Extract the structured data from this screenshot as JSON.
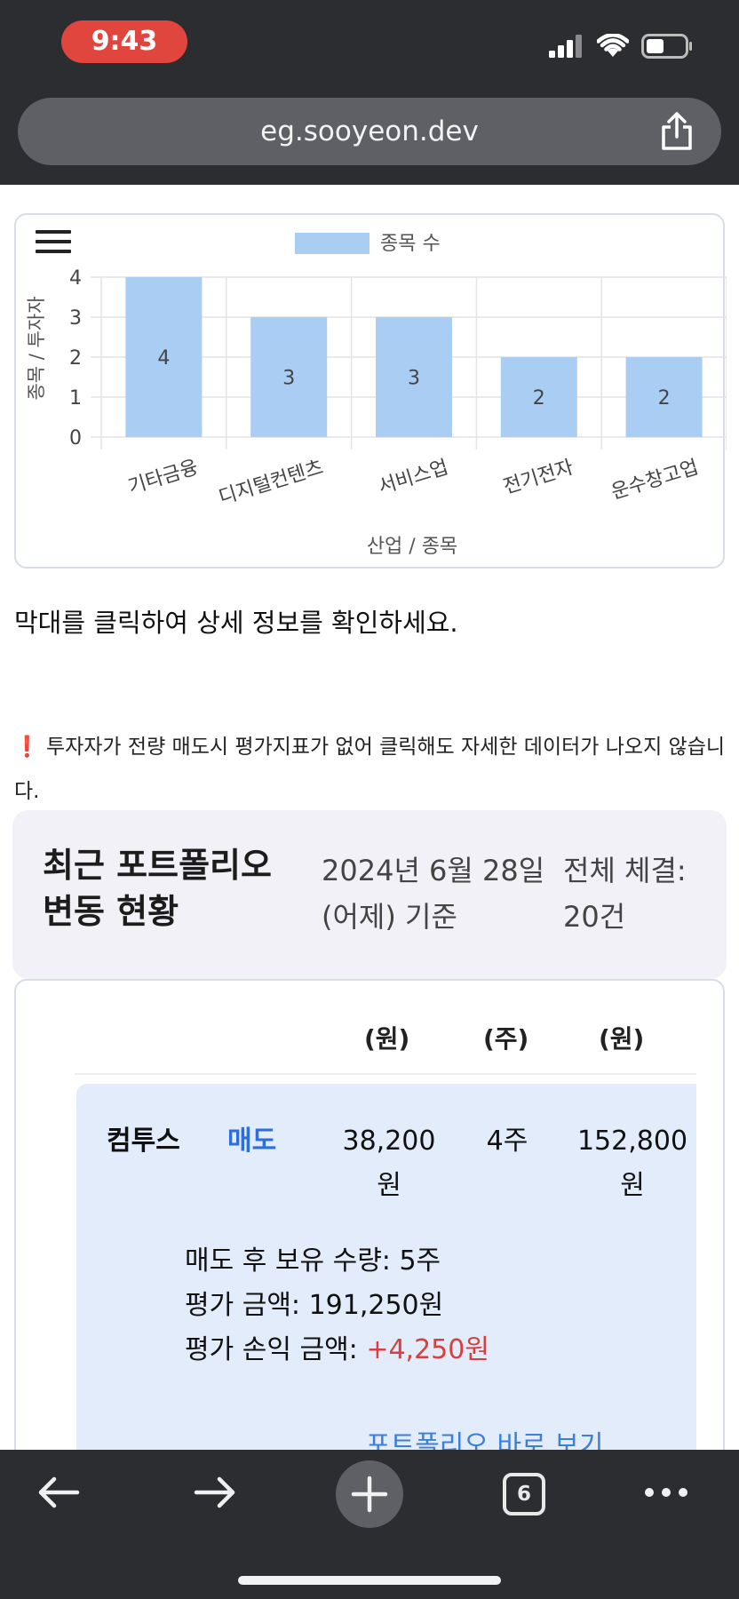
{
  "status_bar": {
    "time": "9:43"
  },
  "browser": {
    "url": "eg.sooyeon.dev",
    "tab_count": "6"
  },
  "chart_data": {
    "type": "bar",
    "legend": "종목 수",
    "categories": [
      "기타금융",
      "디지털컨텐츠",
      "서비스업",
      "전기전자",
      "운수창고업"
    ],
    "values": [
      4,
      3,
      3,
      2,
      2
    ],
    "xlabel": "산업 / 종목",
    "ylabel": "종목 / 투자자",
    "ylim": [
      0,
      4
    ],
    "yticks": [
      "0",
      "1",
      "2",
      "3",
      "4"
    ],
    "bar_color": "#a9cdf3",
    "grid": true
  },
  "instruction": "막대를 클릭하여 상세 정보를 확인하세요.",
  "warning": {
    "mark": "❗",
    "text": " 투자자가 전량 매도시 평가지표가 없어 클릭해도 자세한 데이터가 나오지 않습니다."
  },
  "summary": {
    "title": "최근 포트폴리오 변동 현황",
    "date": "2024년 6월 28일 (어제) 기준",
    "total": "전체 체결: 20건"
  },
  "table": {
    "headers": [
      "(원)",
      "(주)",
      "(원)"
    ],
    "row": {
      "name": "컴투스",
      "type": "매도",
      "price_value": "38,200",
      "price_unit": "원",
      "qty": "4주",
      "amount_value": "152,800",
      "amount_unit": "원",
      "remaining": "매도 후 보유 수량: 5주",
      "eval_amount": "평가 금액: 191,250원",
      "pnl_label": "평가 손익 금액: ",
      "pnl_value": "+4,250원",
      "link": "포트폴리오 바로 보기"
    }
  },
  "colors": {
    "accent_blue": "#2f6ed8",
    "gain_red": "#d64040",
    "status_pill": "#e0463e"
  }
}
